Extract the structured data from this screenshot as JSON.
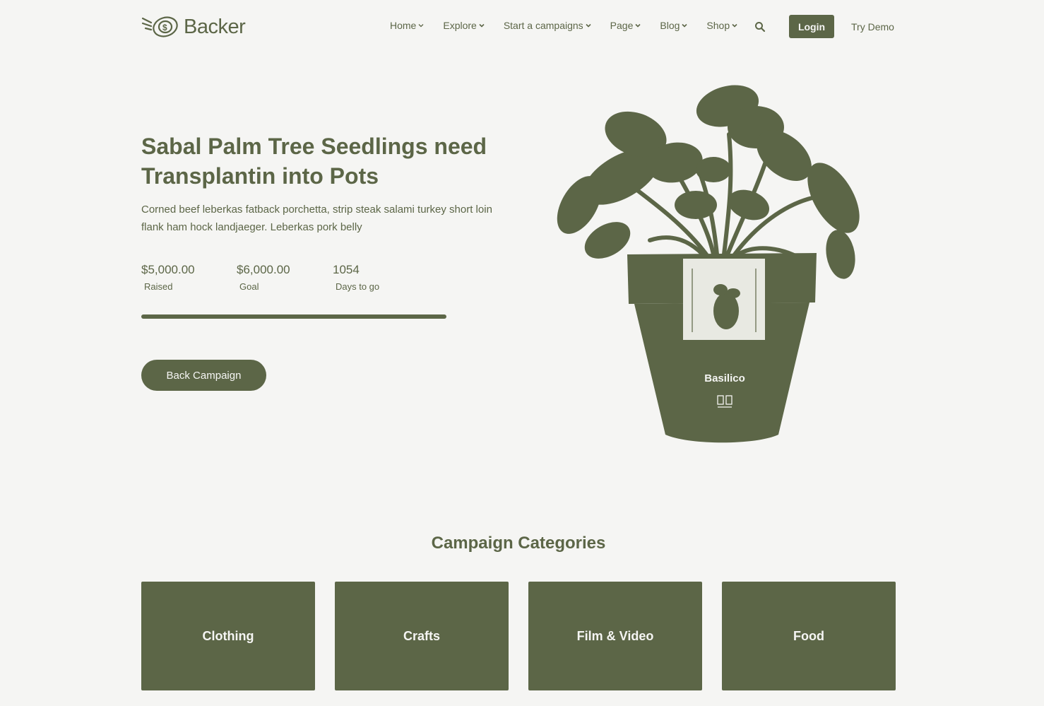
{
  "header": {
    "logo_text": "Backer",
    "nav": [
      {
        "label": "Home"
      },
      {
        "label": "Explore"
      },
      {
        "label": "Start a campaigns"
      },
      {
        "label": "Page"
      },
      {
        "label": "Blog"
      },
      {
        "label": "Shop"
      }
    ],
    "login_label": "Login",
    "try_demo_label": "Try Demo"
  },
  "hero": {
    "title": "Sabal Palm Tree Seedlings need Transplantin into Pots",
    "description": "Corned beef leberkas fatback porchetta, strip steak salami turkey short loin flank ham hock landjaeger. Leberkas pork belly",
    "stats": [
      {
        "value": "$5,000.00",
        "label": "Raised"
      },
      {
        "value": "$6,000.00",
        "label": "Goal"
      },
      {
        "value": "1054",
        "label": "Days to go"
      }
    ],
    "progress": 1.0,
    "button_label": "Back Campaign",
    "pot_label": "Basilico"
  },
  "categories": {
    "heading": "Campaign Categories",
    "items": [
      {
        "label": "Clothing"
      },
      {
        "label": "Crafts"
      },
      {
        "label": "Film & Video"
      },
      {
        "label": "Food"
      }
    ]
  },
  "colors": {
    "accent": "#5c6647",
    "background": "#f5f5f3"
  }
}
